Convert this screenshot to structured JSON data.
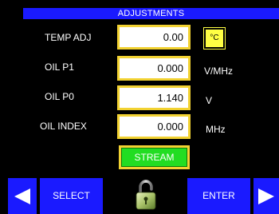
{
  "title": "ADJUSTMENTS",
  "rows": [
    {
      "label": "TEMP ADJ",
      "value": "0.00",
      "unit": "°C"
    },
    {
      "label": "OIL P1",
      "value": "0.000",
      "unit": "V/MHz"
    },
    {
      "label": "OIL P0",
      "value": "1.140",
      "unit": "V"
    },
    {
      "label": "OIL INDEX",
      "value": "0.000",
      "unit": "MHz"
    }
  ],
  "stream_label": "STREAM",
  "nav": {
    "select_label": "SELECT",
    "enter_label": "ENTER",
    "left_icon": "left-arrow-icon",
    "right_icon": "right-arrow-icon",
    "lock_icon": "padlock-icon"
  },
  "colors": {
    "title_bg": "#1a1aff",
    "field_border": "#f2d232",
    "unit_button_bg": "#ffff44",
    "stream_bg": "#22dd22"
  }
}
